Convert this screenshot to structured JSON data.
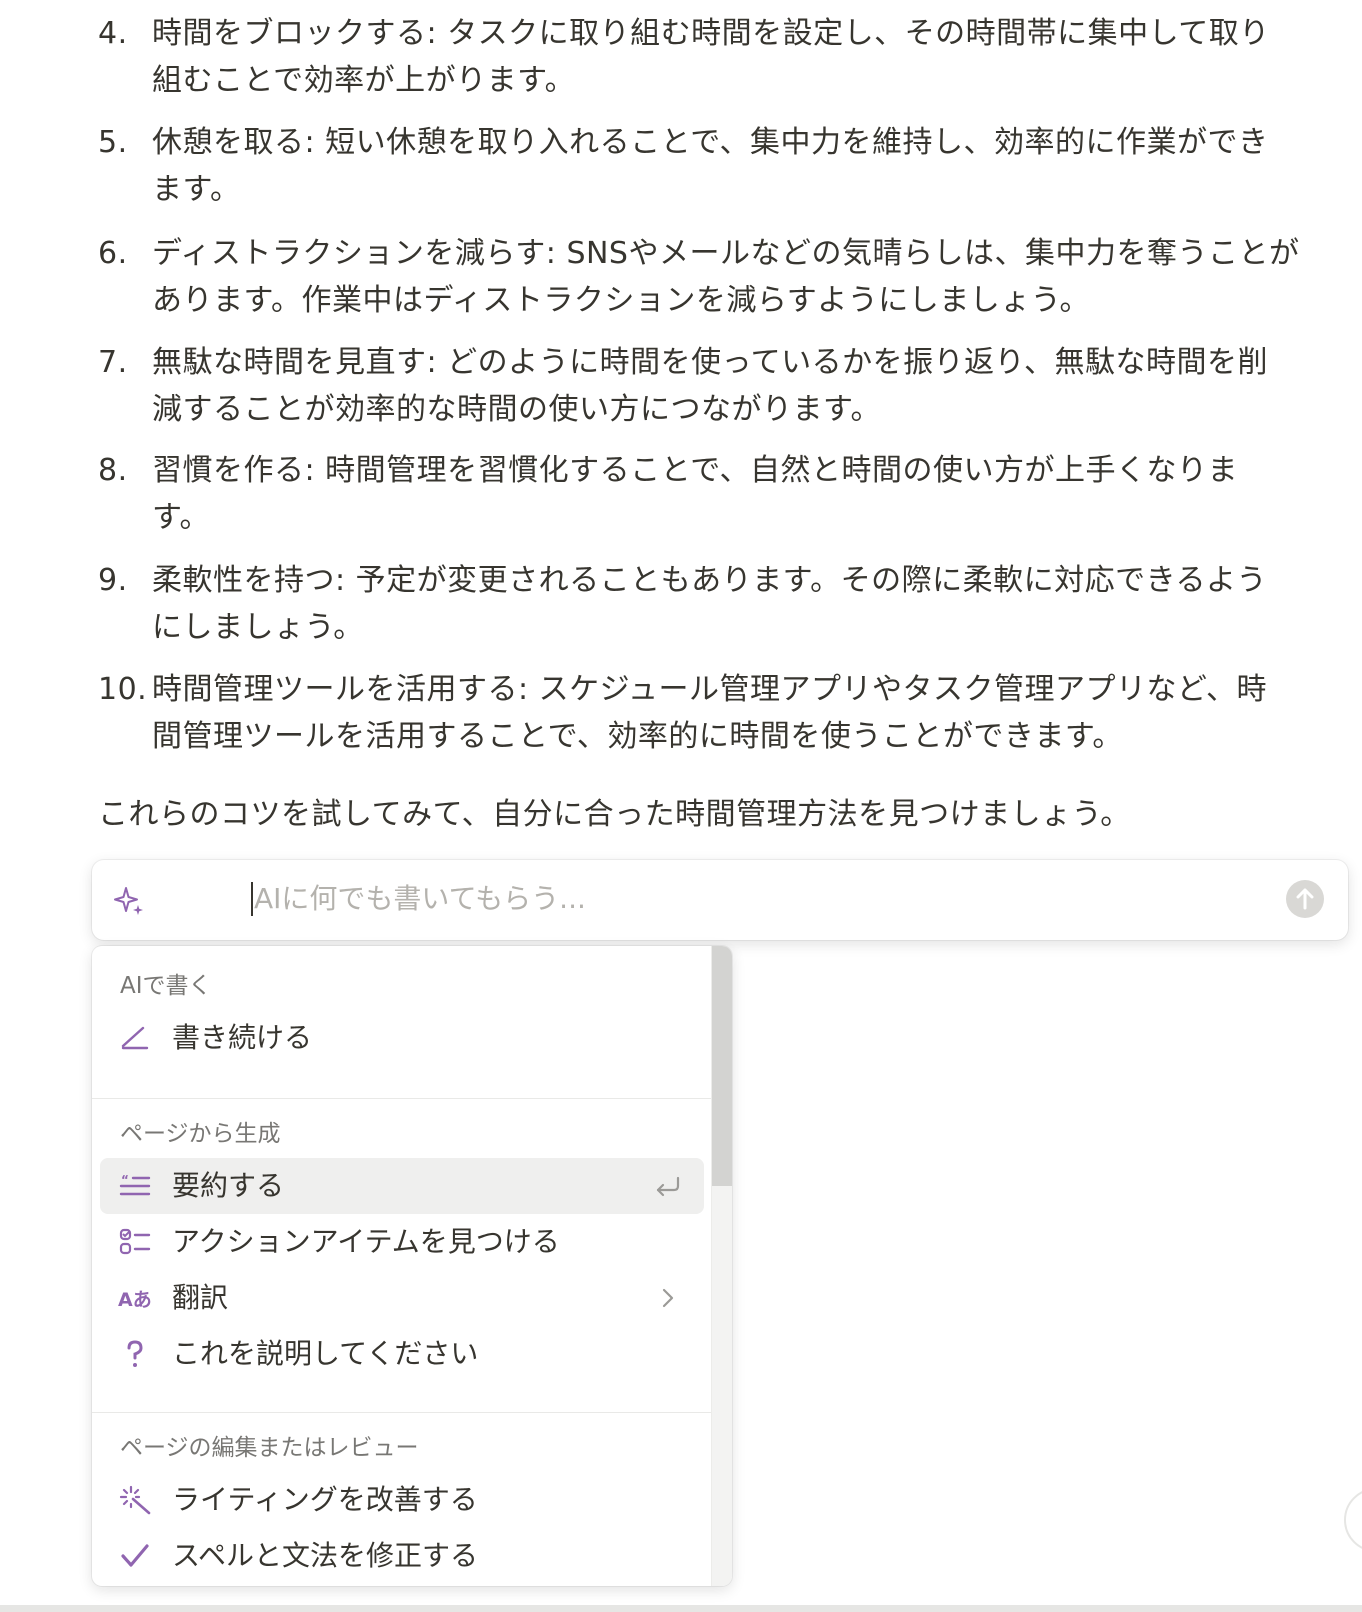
{
  "list": {
    "items": [
      {
        "num": "4.",
        "line1": "時間をブロックする: タスクに取り組む時間を設定し、その時間帯に集中して取り",
        "line2": "組むことで効率が上がります。"
      },
      {
        "num": "5.",
        "line1": "休憩を取る: 短い休憩を取り入れることで、集中力を維持し、効率的に作業ができ",
        "line2": "ます。"
      },
      {
        "num": "6.",
        "line1": "ディストラクションを減らす: SNSやメールなどの気晴らしは、集中力を奪うことが",
        "line2": "あります。作業中はディストラクションを減らすようにしましょう。"
      },
      {
        "num": "7.",
        "line1": "無駄な時間を見直す: どのように時間を使っているかを振り返り、無駄な時間を削",
        "line2": "減することが効率的な時間の使い方につながります。"
      },
      {
        "num": "8.",
        "line1": "習慣を作る: 時間管理を習慣化することで、自然と時間の使い方が上手くなりま",
        "line2": "す。"
      },
      {
        "num": "9.",
        "line1": "柔軟性を持つ: 予定が変更されることもあります。その際に柔軟に対応できるよう",
        "line2": "にしましょう。"
      },
      {
        "num": "10.",
        "line1": "時間管理ツールを活用する: スケジュール管理アプリやタスク管理アプリなど、時",
        "line2": "間管理ツールを活用することで、効率的に時間を使うことができます。"
      }
    ],
    "closing": "これらのコツを試してみて、自分に合った時間管理方法を見つけましょう。"
  },
  "ai_input": {
    "placeholder": "AIに何でも書いてもらう...",
    "value": ""
  },
  "menu": {
    "sections": {
      "write": "AIで書く",
      "generate": "ページから生成",
      "edit": "ページの編集またはレビュー"
    },
    "items": {
      "continue": "書き続ける",
      "summarize": "要約する",
      "action_items": "アクションアイテムを見つける",
      "translate": "翻訳",
      "explain": "これを説明してください",
      "improve": "ライティングを改善する",
      "spelling": "スペルと文法を修正する"
    },
    "translate_icon_text": "Aあ"
  },
  "colors": {
    "accent": "#9065b0",
    "text": "#37352f",
    "muted": "#787774",
    "highlight": "#efefee"
  }
}
